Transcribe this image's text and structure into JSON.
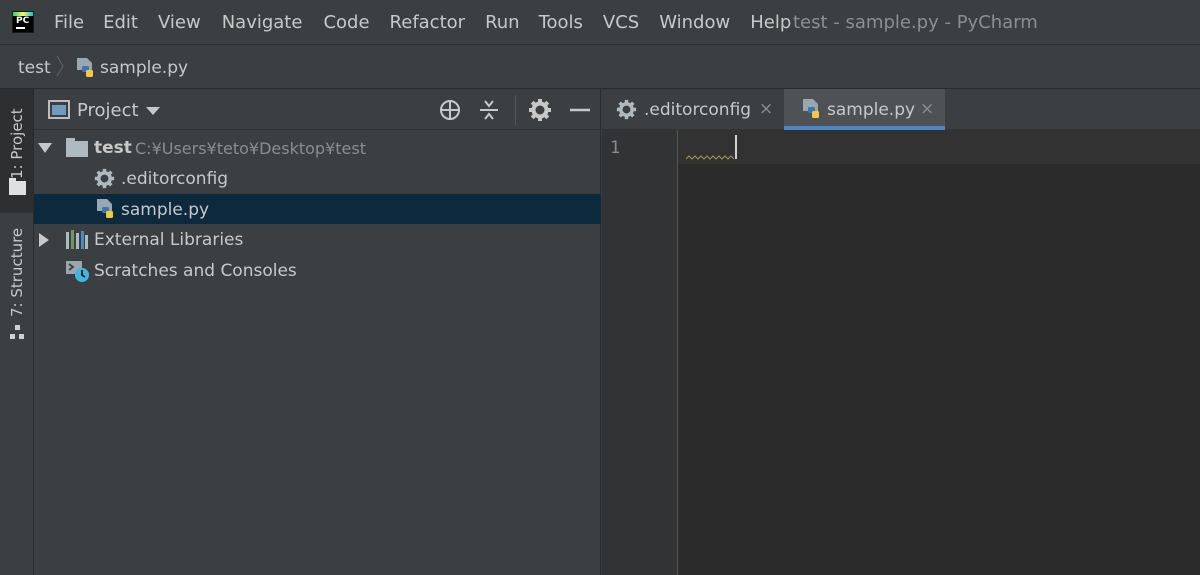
{
  "app": {
    "logo_text": "PC",
    "window_title": "test - sample.py - PyCharm"
  },
  "menu": [
    "File",
    "Edit",
    "View",
    "Navigate",
    "Code",
    "Refactor",
    "Run",
    "Tools",
    "VCS",
    "Window",
    "Help"
  ],
  "breadcrumb": {
    "root": "test",
    "file": "sample.py"
  },
  "tool_stripe": {
    "project_tab": "1: Project",
    "structure_tab": "7: Structure"
  },
  "project_panel": {
    "title": "Project",
    "tree": [
      {
        "label": "test",
        "path": "C:¥Users¥teto¥Desktop¥test",
        "expanded": true,
        "icon": "folder-icon"
      },
      {
        "label": ".editorconfig",
        "icon": "gear-icon"
      },
      {
        "label": "sample.py",
        "icon": "python-file-icon",
        "selected": true
      },
      {
        "label": "External Libraries",
        "expanded": false,
        "icon": "libraries-icon"
      },
      {
        "label": "Scratches and Consoles",
        "icon": "scratches-icon"
      }
    ]
  },
  "editor": {
    "tabs": [
      {
        "label": ".editorconfig",
        "icon": "gear-icon",
        "active": false
      },
      {
        "label": "sample.py",
        "icon": "python-file-icon",
        "active": true
      }
    ],
    "close_glyph": "×",
    "line_numbers": [
      "1"
    ]
  },
  "colors": {
    "background": "#3c3f41",
    "editor_bg": "#2b2b2b",
    "selection": "#0d293e",
    "active_tab_underline": "#4a88c7"
  }
}
